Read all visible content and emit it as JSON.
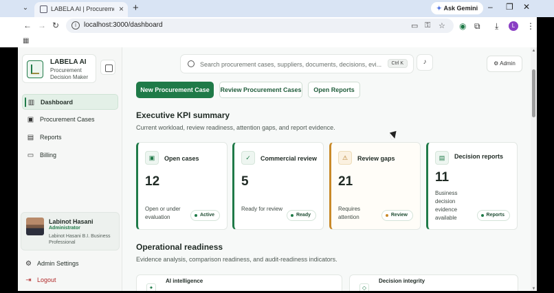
{
  "browser": {
    "tab_title": "LABELA AI | Procurement Decis",
    "gemini_label": "Ask Gemini",
    "url": "localhost:3000/dashboard",
    "profile_initial": "L"
  },
  "brand": {
    "name": "LABELA AI",
    "subtitle": "Procurement Decision Maker"
  },
  "sidebar": {
    "items": [
      {
        "label": "Dashboard",
        "icon": "bar-chart-icon",
        "active": true
      },
      {
        "label": "Procurement Cases",
        "icon": "briefcase-icon",
        "active": false
      },
      {
        "label": "Reports",
        "icon": "document-icon",
        "active": false
      },
      {
        "label": "Billing",
        "icon": "credit-card-icon",
        "active": false
      }
    ],
    "user": {
      "name": "Labinot Hasani",
      "role": "Administrator",
      "org": "Labinot Hasani B.I. Business Professional"
    },
    "admin_settings": "Admin Settings",
    "logout": "Logout"
  },
  "header": {
    "search_placeholder": "Search procurement cases, suppliers, documents, decisions, evi...",
    "shortcut": "Ctrl K",
    "admin_label": "Admin"
  },
  "actions": {
    "new_case": "New Procurement Case",
    "review_cases": "Review Procurement Cases",
    "open_reports": "Open Reports"
  },
  "kpi_section": {
    "title": "Executive KPI summary",
    "subtitle": "Current workload, review readiness, attention gaps, and report evidence.",
    "cards": [
      {
        "title": "Open cases",
        "value": "12",
        "desc": "Open or under evaluation",
        "badge": "Active",
        "icon": "briefcase-icon",
        "tone": "green"
      },
      {
        "title": "Commercial review",
        "value": "5",
        "desc": "Ready for review",
        "badge": "Ready",
        "icon": "check-circle-icon",
        "tone": "green"
      },
      {
        "title": "Review gaps",
        "value": "21",
        "desc": "Requires attention",
        "badge": "Review",
        "icon": "warning-icon",
        "tone": "amber"
      },
      {
        "title": "Decision reports",
        "value": "11",
        "desc": "Business decision evidence available",
        "badge": "Reports",
        "icon": "document-icon",
        "tone": "green"
      }
    ]
  },
  "ops_section": {
    "title": "Operational readiness",
    "subtitle": "Evidence analysis, comparison readiness, and audit-readiness indicators.",
    "cards": [
      {
        "title": "AI intelligence"
      },
      {
        "title": "Decision integrity"
      }
    ]
  },
  "colors": {
    "accent": "#1f7a48",
    "warning": "#c98a2a",
    "danger": "#b12a2a"
  }
}
